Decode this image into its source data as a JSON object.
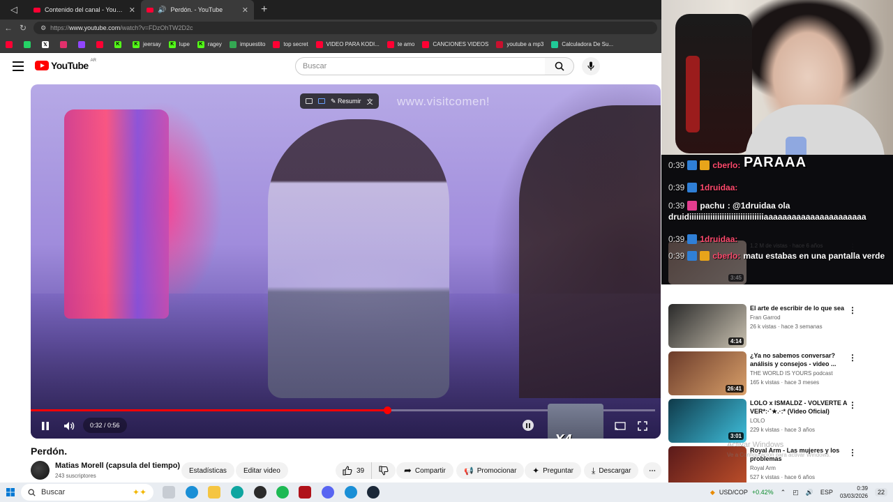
{
  "tabs": [
    {
      "label": "Contenido del canal - YouTube Stu"
    },
    {
      "label": "Perdón. - YouTube"
    }
  ],
  "address": {
    "prefix": "https://",
    "host": "www.youtube.com",
    "path": "/watch?v=FDzOhTW2D2c"
  },
  "bookmarks": [
    {
      "label": "",
      "color": "#ff0033",
      "icon": "youtube-icon"
    },
    {
      "label": "",
      "color": "#25d366",
      "icon": "whatsapp-icon"
    },
    {
      "label": "",
      "color": "#ffffff",
      "icon": "x-icon",
      "glyph": "𝕏"
    },
    {
      "label": "",
      "color": "#e1306c",
      "icon": "instagram-icon"
    },
    {
      "label": "",
      "color": "#9146ff",
      "icon": "twitch-icon"
    },
    {
      "label": "",
      "color": "#ff0033",
      "icon": "pinterest-icon"
    },
    {
      "label": "",
      "color": "#53fc18",
      "icon": "kick-icon",
      "glyph": "K"
    },
    {
      "label": "jeersay",
      "color": "#53fc18",
      "icon": "kick-icon",
      "glyph": "K"
    },
    {
      "label": "lupe",
      "color": "#53fc18",
      "icon": "kick-icon",
      "glyph": "K"
    },
    {
      "label": "ragey",
      "color": "#53fc18",
      "icon": "kick-icon",
      "glyph": "K"
    },
    {
      "label": "impuestito",
      "color": "#34a853",
      "icon": "sheets-icon"
    },
    {
      "label": "top secret",
      "color": "#ff0033",
      "icon": "youtube-icon"
    },
    {
      "label": "VIDEO PARA KODI...",
      "color": "#ff0033",
      "icon": "youtube-icon"
    },
    {
      "label": "te amo",
      "color": "#ff0033",
      "icon": "youtube-icon"
    },
    {
      "label": "CANCIONES VIDEOS",
      "color": "#ff0033",
      "icon": "youtube-icon"
    },
    {
      "label": "youtube a mp3",
      "color": "#c8102e",
      "icon": "converter-icon"
    },
    {
      "label": "Calculadora De Su...",
      "color": "#20c997",
      "icon": "calculator-icon"
    }
  ],
  "yt": {
    "brand": "YouTube",
    "country": "AR",
    "search_placeholder": "Buscar"
  },
  "player": {
    "watermark": "www.visitcomen!",
    "summarize_label": "Resumir",
    "time": "0:32 / 0:56",
    "progress_fraction": 0.571,
    "overlay_text": "X4"
  },
  "video": {
    "title": "Perdón.",
    "channel": "Matias Morell (capsula del tiempo)",
    "subs": "243 suscriptores",
    "stats_label": "Estadísticas",
    "edit_label": "Editar video",
    "likes": "39",
    "share_label": "Compartir",
    "promote_label": "Promocionar",
    "ask_label": "Preguntar",
    "download_label": "Descargar"
  },
  "recommendations": [
    {
      "title": "",
      "channel": "",
      "meta": "1.2 M de vistas · hace 6 años",
      "duration": "3:45",
      "thumb": [
        "#b08877",
        "#e9d3c3"
      ]
    },
    {
      "title": "El arte de escribir de lo que sea",
      "channel": "Fran Garrod",
      "meta": "26 k vistas · hace 3 semanas",
      "duration": "4:14",
      "thumb": [
        "#2a2a2a",
        "#c9c1b0"
      ]
    },
    {
      "title": "¿Ya no sabemos conversar? análisis y consejos - video ...",
      "channel": "THE WORLD IS YOURS podcast",
      "meta": "165 k vistas · hace 3 meses",
      "duration": "26:41",
      "thumb": [
        "#6b3b2a",
        "#d9a06a"
      ]
    },
    {
      "title": "LOLO x ISMALDZ - VOLVERTE A VER*:·˚★.·:* (Video Oficial)",
      "channel": "LOLO",
      "meta": "229 k vistas · hace 3 años",
      "duration": "3:01",
      "thumb": [
        "#0f3a4a",
        "#3fbfdc"
      ]
    },
    {
      "title": "Royal Arm - Las mujeres y los problemas",
      "channel": "Royal Arm",
      "meta": "527 k vistas · hace 6 años",
      "duration": "",
      "thumb": [
        "#5a1a1a",
        "#c0502a"
      ]
    }
  ],
  "chat": {
    "big_text": "PARAAA",
    "rows": [
      {
        "time": "0:39",
        "user": "cberlo:",
        "text": ""
      },
      {
        "time": "0:39",
        "user": "1druidaa:",
        "text": ""
      },
      {
        "time": "0:39",
        "user": "pachu",
        "text": ": @1druidaa ola"
      },
      {
        "time": "0:39",
        "user": "1druidaa:",
        "text": ""
      },
      {
        "time": "0:39",
        "user": "cberlo:",
        "text": "matu estabas en una pantalla verde"
      }
    ],
    "long_line": "druidiiiiiiiiiiiiiiiiiiiiiiiiiiiiiiiiaaaaaaaaaaaaaaaaaaaaaa"
  },
  "taskbar": {
    "search_placeholder": "Buscar",
    "currency": "USD/COP",
    "currency_change": "+0.42%",
    "lang": "ESP",
    "time": "0:39",
    "date": "03/03/2026",
    "notif": "22"
  },
  "windows_activation": {
    "title": "Activar Windows",
    "subtitle": "Ve a Configuración para activar Windows."
  }
}
